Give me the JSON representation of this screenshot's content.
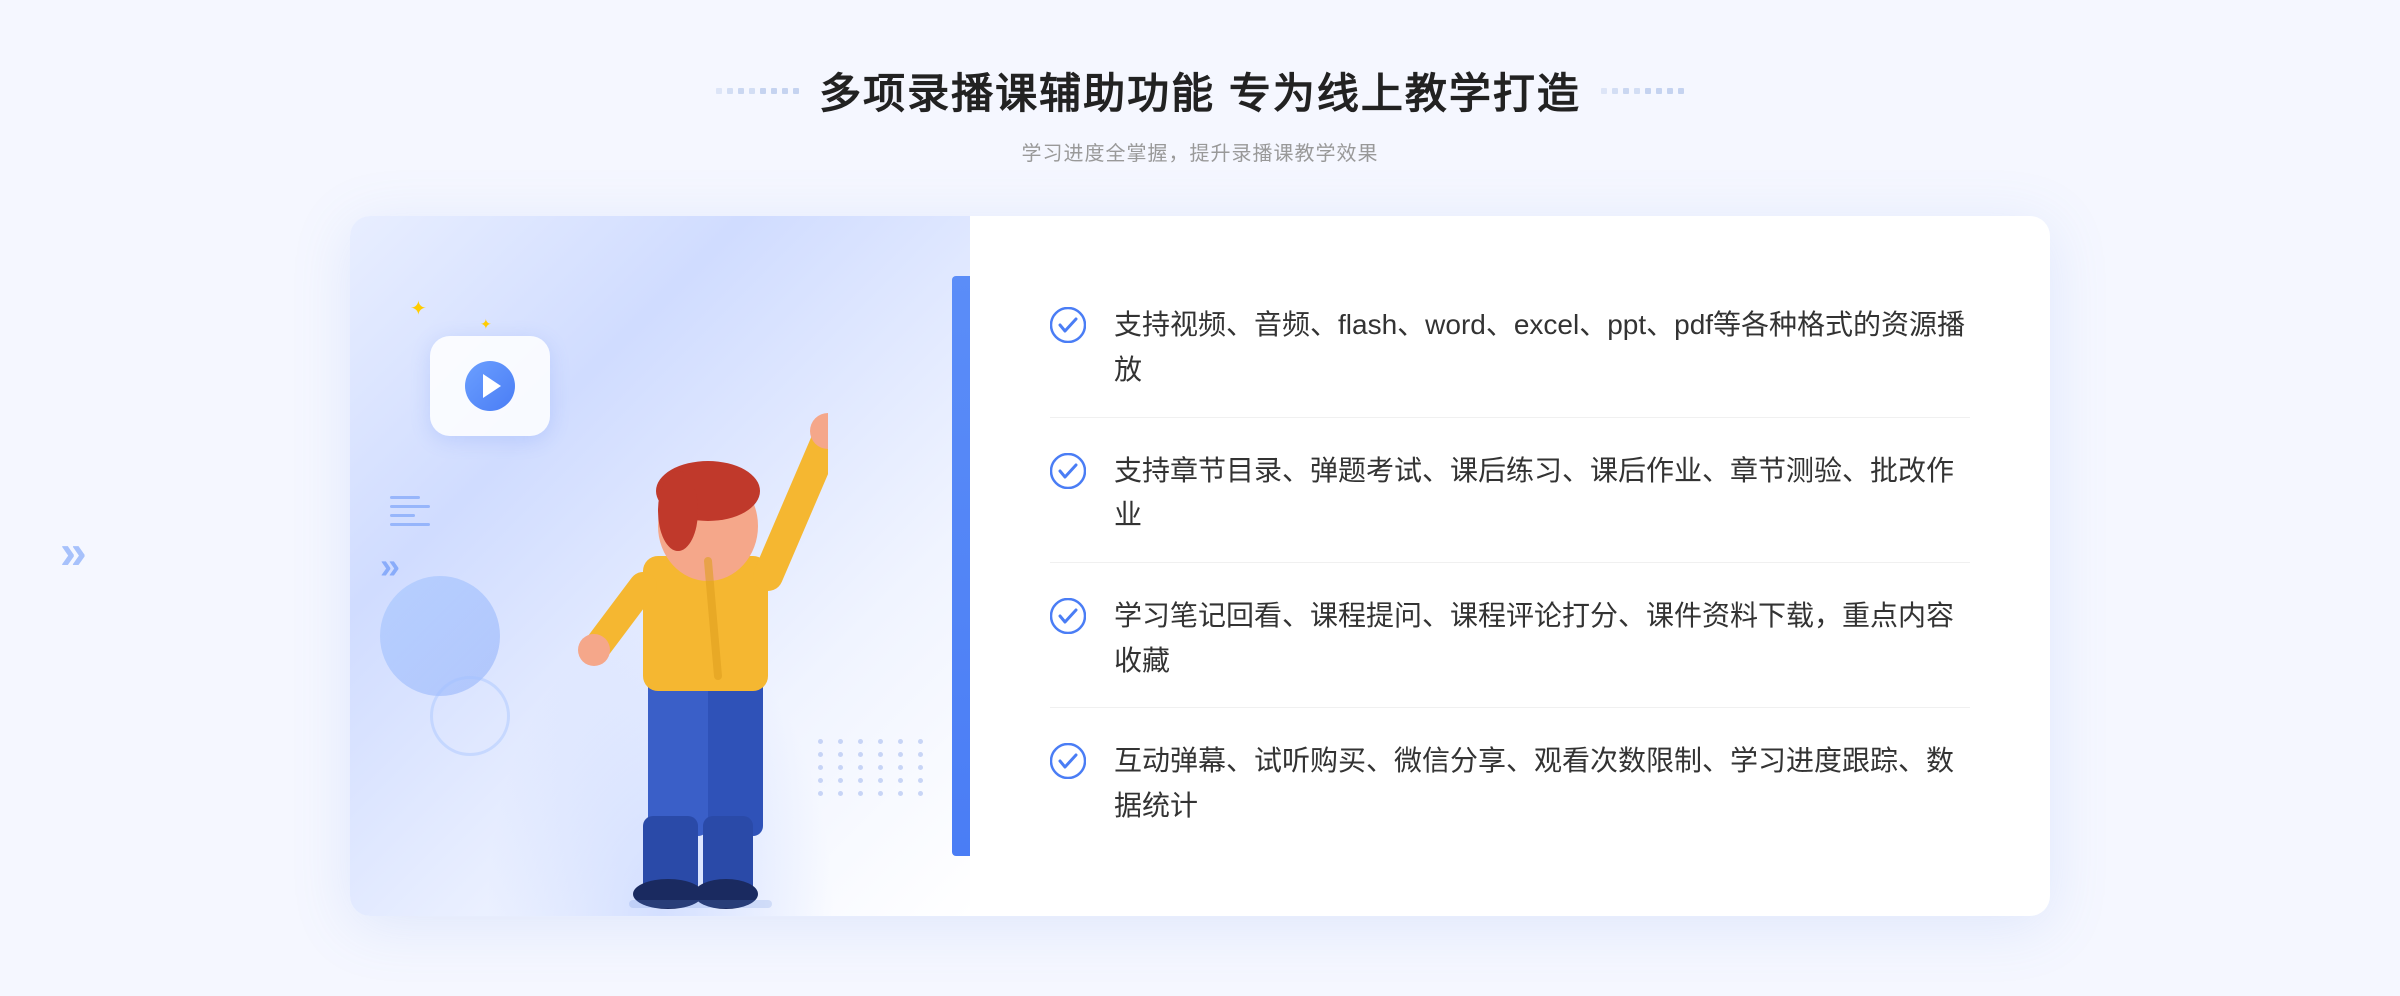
{
  "header": {
    "main_title": "多项录播课辅助功能 专为线上教学打造",
    "sub_title": "学习进度全掌握，提升录播课教学效果"
  },
  "features": [
    {
      "id": "feature-1",
      "text": "支持视频、音频、flash、word、excel、ppt、pdf等各种格式的资源播放"
    },
    {
      "id": "feature-2",
      "text": "支持章节目录、弹题考试、课后练习、课后作业、章节测验、批改作业"
    },
    {
      "id": "feature-3",
      "text": "学习笔记回看、课程提问、课程评论打分、课件资料下载，重点内容收藏"
    },
    {
      "id": "feature-4",
      "text": "互动弹幕、试听购买、微信分享、观看次数限制、学习进度跟踪、数据统计"
    }
  ],
  "colors": {
    "primary_blue": "#4a7df5",
    "light_blue": "#7ab0ff",
    "check_color": "#4a7df5",
    "text_dark": "#333333",
    "text_medium": "#999999",
    "bg_light": "#f5f7ff"
  },
  "decoration": {
    "left_arrow": "»",
    "sparkle": "✦"
  }
}
